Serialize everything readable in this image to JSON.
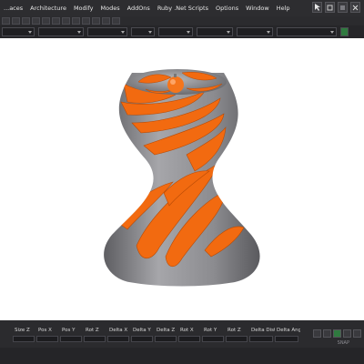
{
  "menubar": {
    "items": [
      "...aces",
      "Architecture",
      "Modify",
      "Modes",
      "AddOns",
      "Ruby .Net Scripts",
      "Options",
      "Window",
      "Help"
    ],
    "icons": [
      "select-arrow-icon",
      "toggle-icon",
      "maximize-icon",
      "close-icon"
    ]
  },
  "statusbar": {
    "labels": [
      "",
      "Size Z",
      "Pos X",
      "Pos Y",
      "Rot Z",
      "Delta X",
      "Delta Y",
      "Delta Z",
      "Rot X",
      "Rot Y",
      "Rot Z",
      "Delta Distanc",
      "Delta Angle"
    ],
    "snap": "SNAP"
  },
  "viewport": {
    "body_color": "#8d8d90",
    "stripe_color": "#f26a10"
  }
}
